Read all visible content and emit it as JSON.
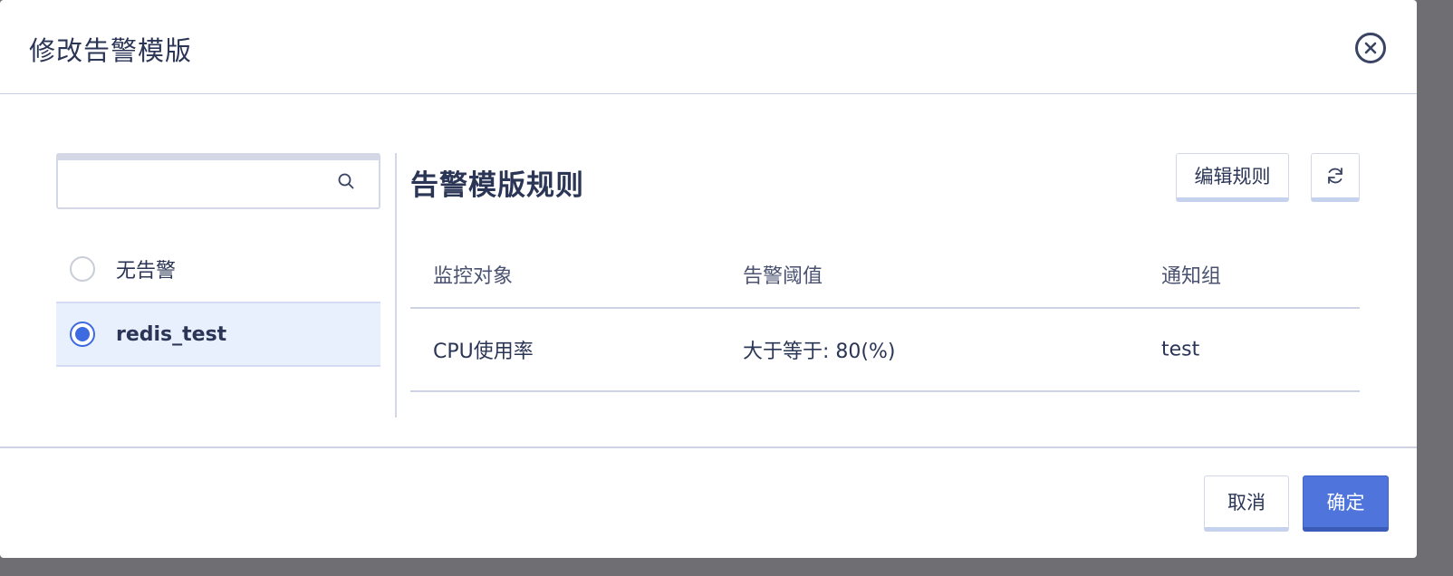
{
  "dialog": {
    "title": "修改告警模版",
    "close_icon": "close-circle-icon"
  },
  "search": {
    "value": "",
    "placeholder": "",
    "icon": "search-icon"
  },
  "templates": [
    {
      "label": "无告警",
      "selected": false
    },
    {
      "label": "redis_test",
      "selected": true
    }
  ],
  "rules_panel": {
    "title": "告警模版规则",
    "edit_button": "编辑规则",
    "refresh_icon": "refresh-icon",
    "columns": [
      "监控对象",
      "告警阈值",
      "通知组"
    ],
    "rows": [
      [
        "CPU使用率",
        "大于等于: 80(%)",
        "test"
      ]
    ]
  },
  "footer": {
    "cancel_label": "取消",
    "confirm_label": "确定"
  },
  "colors": {
    "accent": "#4f74dc",
    "selected_bg": "#e9f0fd",
    "text": "#2b3555"
  }
}
